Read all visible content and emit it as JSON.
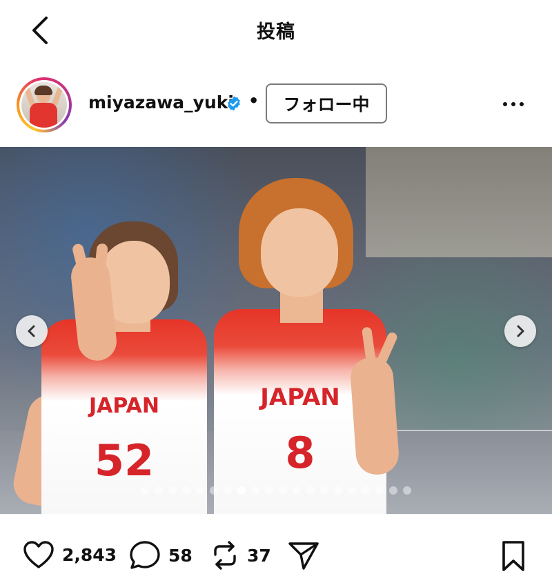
{
  "header": {
    "title": "投稿",
    "back_icon": "chevron-left-icon"
  },
  "profile": {
    "username": "miyazawa_yuki",
    "verified": true,
    "separator": "•",
    "follow_label": "フォロー中"
  },
  "post": {
    "carousel": {
      "total_slides": 20,
      "active_index": 7
    },
    "jerseys": [
      {
        "team": "JAPAN",
        "number": "52"
      },
      {
        "team": "JAPAN",
        "number": "8"
      }
    ]
  },
  "actions": {
    "likes": "2,843",
    "comments": "58",
    "reposts": "37"
  },
  "colors": {
    "text": "#111111",
    "verified_blue": "#1d9bf0",
    "jersey_red": "#d6252a"
  }
}
